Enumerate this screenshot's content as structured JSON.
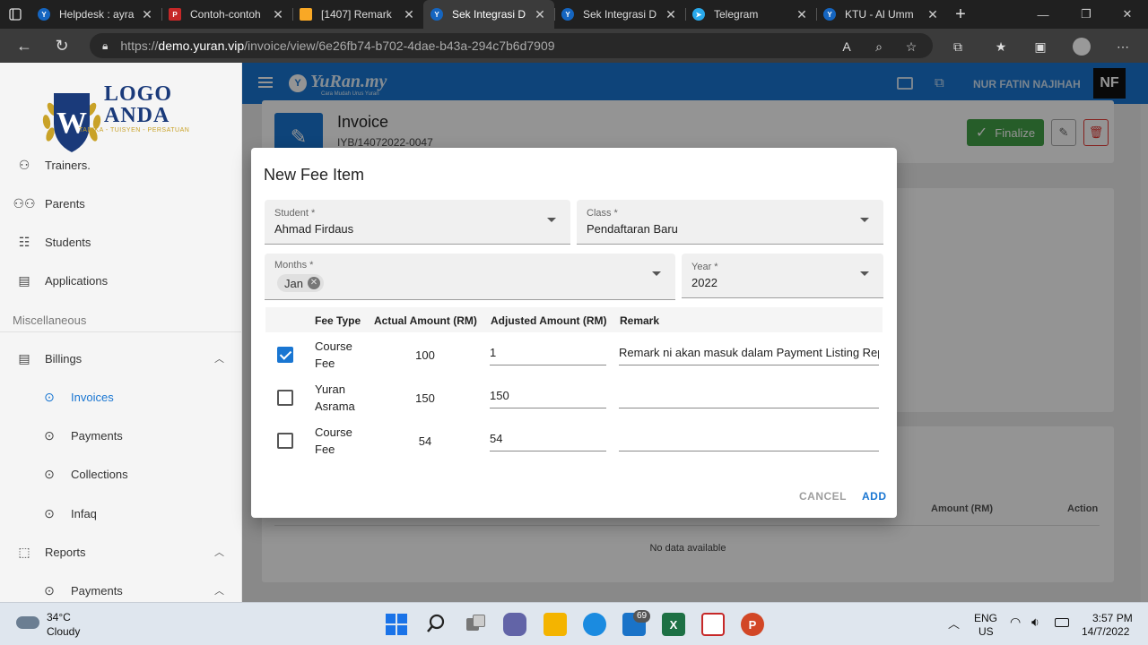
{
  "browser": {
    "tabs": [
      {
        "title": "Helpdesk : ayra",
        "icon_color": "#1565c0",
        "icon": "yuran-icon"
      },
      {
        "title": "Contoh-contoh",
        "icon_color": "#c62828",
        "icon": "pdf-icon"
      },
      {
        "title": "[1407] Remark",
        "icon_color": "#f9a825",
        "icon": "task-icon"
      },
      {
        "title": "Sek Integrasi D",
        "icon_color": "#1565c0",
        "icon": "yuran-icon",
        "active": true
      },
      {
        "title": "Sek Integrasi D",
        "icon_color": "#1565c0",
        "icon": "yuran-icon"
      },
      {
        "title": "Telegram",
        "icon_color": "#29a9eb",
        "icon": "telegram-icon"
      },
      {
        "title": "KTU - Al Umm",
        "icon_color": "#1565c0",
        "icon": "yuran-icon"
      }
    ],
    "url_prefix": "https://",
    "url_host": "demo.yuran.vip",
    "url_path": "/invoice/view/6e26fb74-b702-4dae-b43a-294c7b6d7909"
  },
  "sidebar": {
    "logo_line1": "LOGO",
    "logo_line2": "ANDA",
    "logo_tagline": "TADIKA - TUISYEN - PERSATUAN",
    "items": [
      {
        "label": "Trainers.",
        "icon": "trainer-icon"
      },
      {
        "label": "Parents",
        "icon": "parents-icon"
      },
      {
        "label": "Students",
        "icon": "students-icon"
      },
      {
        "label": "Applications",
        "icon": "applications-icon"
      }
    ],
    "section_misc": "Miscellaneous",
    "billings": "Billings",
    "billing_items": [
      "Invoices",
      "Payments",
      "Collections",
      "Infaq"
    ],
    "reports": "Reports",
    "report_items": [
      "Payments"
    ]
  },
  "topbar": {
    "brand": "YuRan.my",
    "brand_tagline": "Cara Mudah Urus Yuran",
    "user_name": "NUR FATIN NAJIHAH",
    "user_initials": "NF"
  },
  "invoice": {
    "title": "Invoice",
    "number": "IYB/14072022-0047",
    "finalize_label": "Finalize",
    "table_col_amount": "Amount (RM)",
    "table_col_action": "Action",
    "no_data": "No data available"
  },
  "dialog": {
    "title": "New Fee Item",
    "student_label": "Student *",
    "student_value": "Ahmad Firdaus",
    "class_label": "Class *",
    "class_value": "Pendaftaran Baru",
    "months_label": "Months *",
    "months_chip": "Jan",
    "year_label": "Year *",
    "year_value": "2022",
    "columns": [
      "Fee Type",
      "Actual Amount (RM)",
      "Adjusted Amount (RM)",
      "Remark"
    ],
    "rows": [
      {
        "checked": true,
        "fee_type_1": "Course",
        "fee_type_2": "Fee",
        "actual": "100",
        "adjusted": "1",
        "remark": "Remark ni akan masuk dalam Payment Listing Repo"
      },
      {
        "checked": false,
        "fee_type_1": "Yuran",
        "fee_type_2": "Asrama",
        "actual": "150",
        "adjusted": "150",
        "remark": ""
      },
      {
        "checked": false,
        "fee_type_1": "Course",
        "fee_type_2": "Fee",
        "actual": "54",
        "adjusted": "54",
        "remark": ""
      }
    ],
    "cancel_label": "CANCEL",
    "add_label": "ADD"
  },
  "taskbar": {
    "weather_temp": "34°C",
    "weather_desc": "Cloudy",
    "mail_badge": "69",
    "lang_1": "ENG",
    "lang_2": "US",
    "time": "3:57 PM",
    "date": "14/7/2022"
  },
  "colors": {
    "primary": "#1976d2",
    "finalize": "#43a047",
    "delete": "#e53935"
  }
}
